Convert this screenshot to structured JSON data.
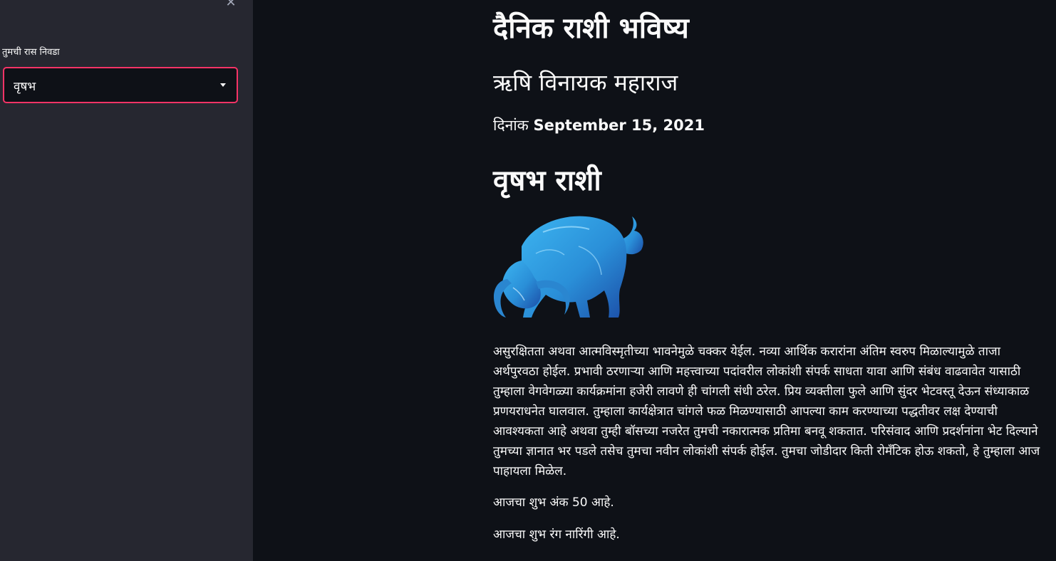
{
  "sidebar": {
    "close_icon": "close-icon",
    "select_label": "तुमची रास निवडा",
    "selected_rashi": "वृषभ"
  },
  "main": {
    "title": "दैनिक राशी भविष्य",
    "subtitle": "ऋषि विनायक महाराज",
    "date_prefix": "दिनांक",
    "date_value": "September 15, 2021",
    "rashi_heading": "वृषभ राशी",
    "rashi_image": "taurus-bull-illustration",
    "horoscope_text": "असुरक्षितता अथवा आत्मविस्मृतीच्या भावनेमुळे चक्कर येईल. नव्या आर्थिक करारांना अंतिम स्वरुप मिळाल्यामुळे ताजा अर्थपुरवठा होईल. प्रभावी ठरणाऱ्या आणि महत्त्वाच्या पदांवरील लोकांशी संपर्क साधता यावा आणि संबंध वाढवावेत यासाठी तुम्हाला वेगवेगळ्या कार्यक्रमांना हजेरी लावणे ही चांगली संधी ठरेल. प्रिय व्यक्तीला फुले आणि सुंदर भेटवस्तू देऊन संध्याकाळ प्रणयराधनेत घालवाल. तुम्हाला कार्यक्षेत्रात चांगले फळ मिळण्यासाठी आपल्या काम करण्याच्या पद्धतीवर लक्ष देण्याची आवश्यकता आहे अथवा तुम्ही बॉसच्या नजरेत तुमची नकारात्मक प्रतिमा बनवू शकतात. परिसंवाद आणि प्रदर्शनांना भेट दिल्याने तुमच्या ज्ञानात भर पडले तसेच तुमचा नवीन लोकांशी संपर्क होईल. तुमचा जोडीदार किती रोमँटिक होऊ शकतो, हे तुम्हाला आज पाहायला मिळेल.",
    "lucky_number_text": "आजचा शुभ अंक 50 आहे.",
    "lucky_color_text": "आजचा शुभ रंग नारिंगी आहे."
  },
  "colors": {
    "sidebar_bg": "#262730",
    "main_bg": "#0e1117",
    "accent": "#f63366",
    "text": "#fafafa",
    "bull_blue": "#2a9ee0"
  }
}
